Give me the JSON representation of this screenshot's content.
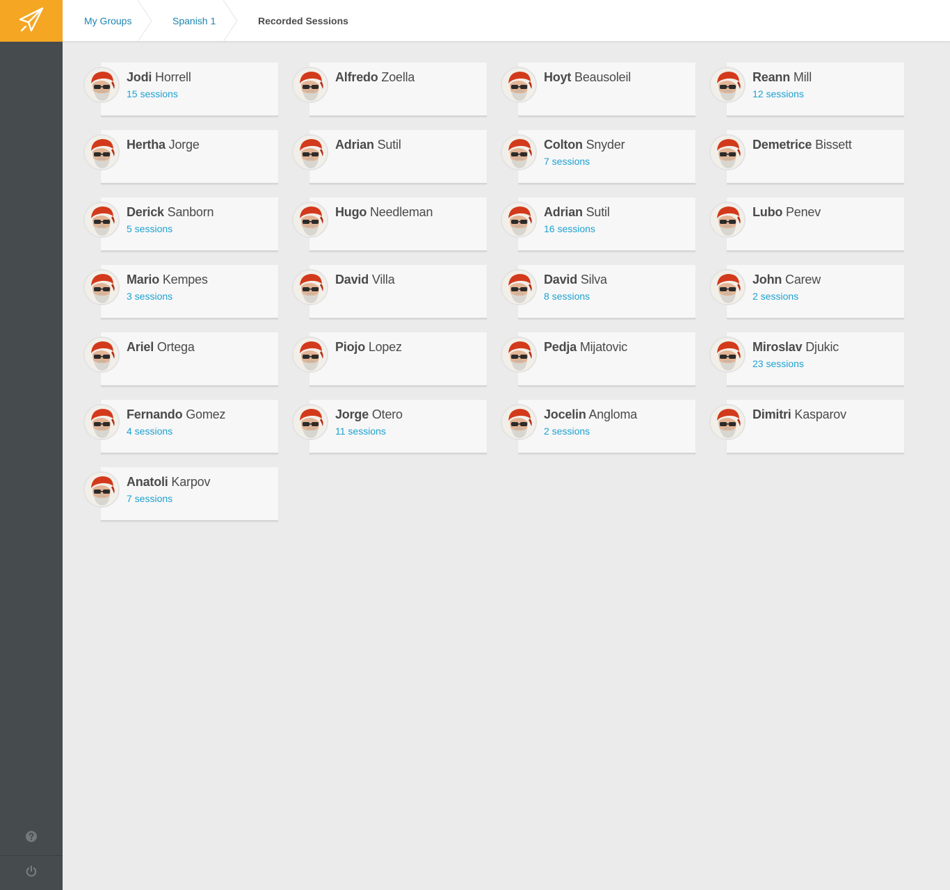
{
  "breadcrumb": [
    {
      "label": "My Groups"
    },
    {
      "label": "Spanish 1"
    },
    {
      "label": "Recorded Sessions"
    }
  ],
  "colors": {
    "accent": "#f5a623",
    "sidebar": "#464b4e",
    "link": "#1b84b1",
    "sessions": "#1da1d0"
  },
  "icons": {
    "logo": "paper-plane-icon",
    "help": "help-icon",
    "power": "power-icon"
  },
  "students": [
    {
      "first": "Jodi",
      "last": "Horrell",
      "sessions": "15 sessions"
    },
    {
      "first": "Alfredo",
      "last": "Zoella",
      "sessions": ""
    },
    {
      "first": "Hoyt",
      "last": "Beausoleil",
      "sessions": ""
    },
    {
      "first": "Reann",
      "last": "Mill",
      "sessions": "12 sessions"
    },
    {
      "first": "Hertha",
      "last": "Jorge",
      "sessions": ""
    },
    {
      "first": "Adrian",
      "last": "Sutil",
      "sessions": ""
    },
    {
      "first": "Colton",
      "last": "Snyder",
      "sessions": "7 sessions"
    },
    {
      "first": "Demetrice",
      "last": "Bissett",
      "sessions": ""
    },
    {
      "first": "Derick",
      "last": "Sanborn",
      "sessions": "5 sessions"
    },
    {
      "first": "Hugo",
      "last": "Needleman",
      "sessions": ""
    },
    {
      "first": "Adrian",
      "last": "Sutil",
      "sessions": "16 sessions"
    },
    {
      "first": "Lubo",
      "last": "Penev",
      "sessions": ""
    },
    {
      "first": "Mario",
      "last": "Kempes",
      "sessions": "3 sessions"
    },
    {
      "first": "David",
      "last": "Villa",
      "sessions": ""
    },
    {
      "first": "David",
      "last": "Silva",
      "sessions": "8 sessions"
    },
    {
      "first": "John",
      "last": "Carew",
      "sessions": "2 sessions"
    },
    {
      "first": "Ariel",
      "last": "Ortega",
      "sessions": ""
    },
    {
      "first": "Piojo",
      "last": "Lopez",
      "sessions": ""
    },
    {
      "first": "Pedja",
      "last": "Mijatovic",
      "sessions": ""
    },
    {
      "first": "Miroslav",
      "last": "Djukic",
      "sessions": "23 sessions"
    },
    {
      "first": "Fernando",
      "last": "Gomez",
      "sessions": "4 sessions"
    },
    {
      "first": "Jorge",
      "last": "Otero",
      "sessions": "11 sessions"
    },
    {
      "first": "Jocelin",
      "last": "Angloma",
      "sessions": "2 sessions"
    },
    {
      "first": "Dimitri",
      "last": "Kasparov",
      "sessions": ""
    },
    {
      "first": "Anatoli",
      "last": "Karpov",
      "sessions": "7 sessions"
    }
  ]
}
